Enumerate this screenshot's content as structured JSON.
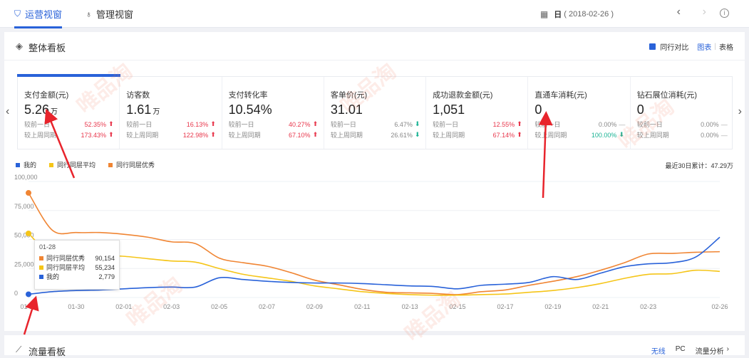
{
  "tabs": [
    {
      "label": "运营视窗",
      "icon": "shield-icon"
    },
    {
      "label": "管理视窗",
      "icon": "medal-icon"
    }
  ],
  "date": {
    "prefix": "日",
    "value": "( 2018-02-26 )"
  },
  "panel": {
    "title": "整体看板",
    "compare_label": "同行对比",
    "view_chart": "图表",
    "view_table": "表格",
    "separator": "|"
  },
  "metrics": [
    {
      "label": "支付金额(元)",
      "value": "5.26",
      "unit": "万",
      "rows": [
        {
          "label": "较前一日",
          "pct": "52.35%",
          "trend": "up"
        },
        {
          "label": "较上周同期",
          "pct": "173.43%",
          "trend": "up"
        }
      ]
    },
    {
      "label": "访客数",
      "value": "1.61",
      "unit": "万",
      "rows": [
        {
          "label": "较前一日",
          "pct": "16.13%",
          "trend": "up"
        },
        {
          "label": "较上周同期",
          "pct": "122.98%",
          "trend": "up"
        }
      ]
    },
    {
      "label": "支付转化率",
      "value": "10.54%",
      "unit": "",
      "rows": [
        {
          "label": "较前一日",
          "pct": "40.27%",
          "trend": "up"
        },
        {
          "label": "较上周同期",
          "pct": "67.10%",
          "trend": "up"
        }
      ]
    },
    {
      "label": "客单价(元)",
      "value": "31.01",
      "unit": "",
      "rows": [
        {
          "label": "较前一日",
          "pct": "6.47%",
          "trend": "down"
        },
        {
          "label": "较上周同期",
          "pct": "26.61%",
          "trend": "down"
        }
      ]
    },
    {
      "label": "成功退款金额(元)",
      "value": "1,051",
      "unit": "",
      "rows": [
        {
          "label": "较前一日",
          "pct": "12.55%",
          "trend": "up"
        },
        {
          "label": "较上周同期",
          "pct": "67.14%",
          "trend": "up"
        }
      ]
    },
    {
      "label": "直通车消耗(元)",
      "value": "0",
      "unit": "",
      "rows": [
        {
          "label": "较前一日",
          "pct": "0.00%",
          "trend": "flat"
        },
        {
          "label": "较上周同期",
          "pct": "100.00%",
          "trend": "down"
        }
      ]
    },
    {
      "label": "钻石展位消耗(元)",
      "value": "0",
      "unit": "",
      "rows": [
        {
          "label": "较前一日",
          "pct": "0.00%",
          "trend": "flat"
        },
        {
          "label": "较上周同期",
          "pct": "0.00%",
          "trend": "flat"
        }
      ]
    }
  ],
  "legend": [
    {
      "name": "我的",
      "color": "#2962d9"
    },
    {
      "name": "同行同层平均",
      "color": "#f5c518"
    },
    {
      "name": "同行同层优秀",
      "color": "#f08533"
    }
  ],
  "total_label": "最近30日累计：47.29万",
  "tooltip": {
    "date": "01-28",
    "rows": [
      {
        "name": "同行同层优秀",
        "value": "90,154",
        "color": "#f08533"
      },
      {
        "name": "同行同层平均",
        "value": "55,234",
        "color": "#f5c518"
      },
      {
        "name": "我的",
        "value": "2,779",
        "color": "#2962d9"
      }
    ]
  },
  "chart_data": {
    "type": "line",
    "x": [
      "01-28",
      "01-29",
      "01-30",
      "01-31",
      "02-01",
      "02-02",
      "02-03",
      "02-04",
      "02-05",
      "02-06",
      "02-07",
      "02-08",
      "02-09",
      "02-10",
      "02-11",
      "02-12",
      "02-13",
      "02-14",
      "02-15",
      "02-16",
      "02-17",
      "02-18",
      "02-19",
      "02-20",
      "02-21",
      "02-22",
      "02-23",
      "02-24",
      "02-25",
      "02-26"
    ],
    "tick_labels": [
      "01-28",
      "01-30",
      "02-01",
      "02-03",
      "02-05",
      "02-07",
      "02-09",
      "02-11",
      "02-13",
      "02-15",
      "02-17",
      "02-19",
      "02-21",
      "02-23",
      "02-26"
    ],
    "yticks": [
      "0",
      "25,000",
      "50,000",
      "75,000",
      "100,000"
    ],
    "ylim": [
      0,
      100000
    ],
    "series": [
      {
        "name": "我的",
        "color": "#2962d9",
        "values": [
          2779,
          5000,
          6000,
          6500,
          7500,
          8500,
          9000,
          9000,
          17000,
          15500,
          14000,
          13000,
          12500,
          12500,
          12000,
          11000,
          10000,
          9500,
          7500,
          10500,
          11500,
          13000,
          18000,
          15500,
          21000,
          26500,
          29000,
          30000,
          35000,
          52000
        ]
      },
      {
        "name": "同行同层平均",
        "color": "#f5c518",
        "values": [
          55234,
          36000,
          36500,
          36500,
          35500,
          33500,
          31500,
          30500,
          25000,
          20000,
          17000,
          14000,
          10000,
          7500,
          5000,
          3500,
          2500,
          2000,
          2000,
          2500,
          3000,
          4500,
          6000,
          8500,
          12000,
          16500,
          20000,
          20500,
          23500,
          22500
        ]
      },
      {
        "name": "同行同层优秀",
        "color": "#f08533",
        "values": [
          90154,
          58000,
          56000,
          56000,
          54500,
          52000,
          48000,
          46500,
          34000,
          30000,
          27000,
          21500,
          15000,
          11000,
          7000,
          4500,
          4000,
          3500,
          2500,
          5000,
          6500,
          10500,
          14000,
          18000,
          23500,
          30000,
          37500,
          38000,
          39000,
          39500
        ]
      }
    ]
  },
  "bottom": {
    "title": "流量看板",
    "right": [
      "无线",
      "PC",
      "流量分析"
    ]
  },
  "watermark": "唯品淘"
}
